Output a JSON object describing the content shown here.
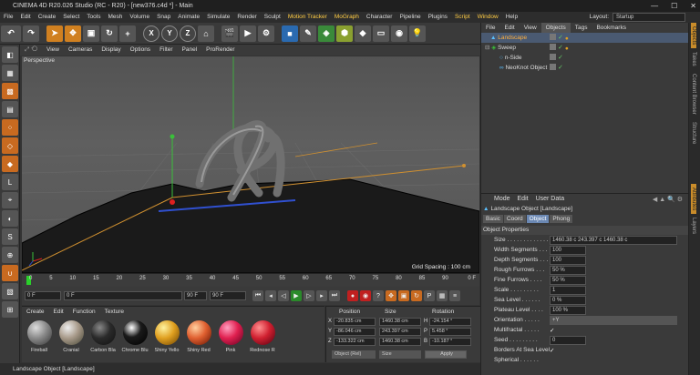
{
  "window": {
    "title": "CINEMA 4D R20.026 Studio (RC - R20) - [new376.c4d *] - Main",
    "min": "—",
    "max": "☐",
    "close": "✕"
  },
  "menu": [
    "File",
    "Edit",
    "Create",
    "Select",
    "Tools",
    "Mesh",
    "Volume",
    "Snap",
    "Animate",
    "Simulate",
    "Render",
    "Sculpt",
    "Motion Tracker",
    "MoGraph",
    "Character",
    "Pipeline",
    "Plugins",
    "Script",
    "Window",
    "Help"
  ],
  "layout": {
    "label": "Layout:",
    "value": "Startup"
  },
  "toolbar": {
    "x": "X",
    "y": "Y",
    "z": "Z"
  },
  "viewport": {
    "menu": [
      "View",
      "Cameras",
      "Display",
      "Options",
      "Filter",
      "Panel",
      "ProRender"
    ],
    "label": "Perspective",
    "grid_spacing": "Grid Spacing : 100 cm"
  },
  "timeline": {
    "ticks": [
      "0",
      "5",
      "10",
      "15",
      "20",
      "25",
      "30",
      "35",
      "40",
      "45",
      "50",
      "55",
      "60",
      "65",
      "70",
      "75",
      "80",
      "85",
      "90"
    ],
    "end": "0 F"
  },
  "transport": {
    "start": "0 F",
    "current": "0 F",
    "end1": "90 F",
    "end2": "90 F"
  },
  "materials": {
    "menu": [
      "Create",
      "Edit",
      "Function",
      "Texture"
    ],
    "items": [
      {
        "name": "Fireball",
        "color": "#8a8a8a"
      },
      {
        "name": "Cranial",
        "color": "#a89a8a"
      },
      {
        "name": "Carbon Bla",
        "color": "#2a2a2a"
      },
      {
        "name": "Chrome Blu",
        "color": "#1a1a1a"
      },
      {
        "name": "Shiny Yello",
        "color": "#e0a020"
      },
      {
        "name": "Shiny Red",
        "color": "#e06030"
      },
      {
        "name": "Pink",
        "color": "#e02050"
      },
      {
        "name": "Rednose R",
        "color": "#d02030"
      }
    ]
  },
  "coords": {
    "headers": [
      "Position",
      "Size",
      "Rotation"
    ],
    "rows": [
      {
        "axis": "X",
        "pos": "-20.835 cm",
        "size": "1460.38 cm",
        "rot_axis": "H",
        "rot": "-24.154 °"
      },
      {
        "axis": "Y",
        "pos": "-86.046 cm",
        "size": "243.397 cm",
        "rot_axis": "P",
        "rot": "5.458 °"
      },
      {
        "axis": "Z",
        "pos": "-133.322 cm",
        "size": "1460.38 cm",
        "rot_axis": "B",
        "rot": "-10.187 °"
      }
    ],
    "mode": "Object (Rel)",
    "size_mode": "Size",
    "apply": "Apply"
  },
  "status": "Landscape Object [Landscape]",
  "objects": {
    "menu": [
      "File",
      "Edit",
      "View",
      "Objects",
      "Tags",
      "Bookmarks"
    ],
    "items": [
      {
        "name": "Landscape",
        "indent": 0,
        "selected": true
      },
      {
        "name": "Sweep",
        "indent": 0,
        "selected": false
      },
      {
        "name": "n-Side",
        "indent": 1,
        "selected": false
      },
      {
        "name": "NeoKnot Object",
        "indent": 1,
        "selected": false
      }
    ]
  },
  "attributes": {
    "menu": [
      "Mode",
      "Edit",
      "User Data"
    ],
    "title": "Landscape Object [Landscape]",
    "tabs": [
      "Basic",
      "Coord",
      "Object",
      "Phong"
    ],
    "active_tab": "Object",
    "section": "Object Properties",
    "props": [
      {
        "label": "Size . . . . . . . . . . . . .",
        "value": "1460.38 c  243.397 c  1460.38 c"
      },
      {
        "label": "Width Segments . . .",
        "value": "100"
      },
      {
        "label": "Depth Segments . . .",
        "value": "100"
      },
      {
        "label": "Rough Furrows . . .",
        "value": "50 %"
      },
      {
        "label": "Fine Furrows . . . .",
        "value": "50 %"
      },
      {
        "label": "Scale . . . . . . . . .",
        "value": "1"
      },
      {
        "label": "Sea Level . . . . . .",
        "value": "0 %"
      },
      {
        "label": "Plateau Level . . . .",
        "value": "100 %"
      },
      {
        "label": "Orientation . . . . .",
        "value": "+Y"
      },
      {
        "label": "Multifractal . . . . .",
        "value": "✓"
      },
      {
        "label": "Seed . . . . . . . . .",
        "value": "0"
      },
      {
        "label": "Borders At Sea Level",
        "value": "✓"
      },
      {
        "label": "Spherical . . . . . .",
        "value": ""
      }
    ]
  },
  "side_tabs": [
    "Objects",
    "Takes",
    "Content Browser",
    "Structure",
    "Attributes",
    "Layers"
  ]
}
